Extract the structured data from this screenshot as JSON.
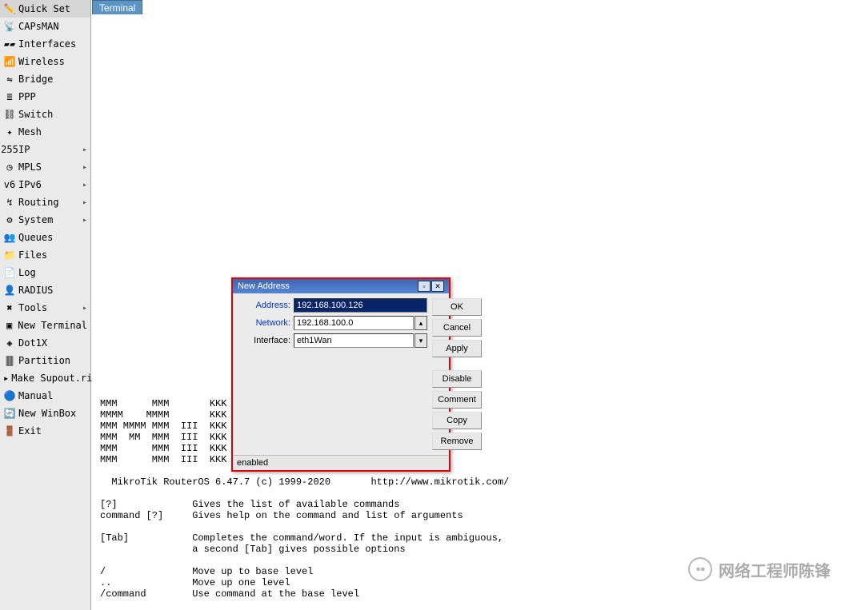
{
  "app_title": "Terminal",
  "sidebar": {
    "items": [
      {
        "label": "Quick Set",
        "icon": "✏️",
        "sub": false
      },
      {
        "label": "CAPsMAN",
        "icon": "📡",
        "sub": false
      },
      {
        "label": "Interfaces",
        "icon": "▰▰",
        "sub": false
      },
      {
        "label": "Wireless",
        "icon": "📶",
        "sub": false
      },
      {
        "label": "Bridge",
        "icon": "⇋",
        "sub": false
      },
      {
        "label": "PPP",
        "icon": "≣",
        "sub": false
      },
      {
        "label": "Switch",
        "icon": "⛓",
        "sub": false
      },
      {
        "label": "Mesh",
        "icon": "✦",
        "sub": false
      },
      {
        "label": "IP",
        "icon": "255",
        "sub": true
      },
      {
        "label": "MPLS",
        "icon": "◷",
        "sub": true
      },
      {
        "label": "IPv6",
        "icon": "v6",
        "sub": true
      },
      {
        "label": "Routing",
        "icon": "↯",
        "sub": true
      },
      {
        "label": "System",
        "icon": "⚙",
        "sub": true
      },
      {
        "label": "Queues",
        "icon": "👥",
        "sub": false
      },
      {
        "label": "Files",
        "icon": "📁",
        "sub": false
      },
      {
        "label": "Log",
        "icon": "📄",
        "sub": false
      },
      {
        "label": "RADIUS",
        "icon": "👤",
        "sub": false
      },
      {
        "label": "Tools",
        "icon": "✖",
        "sub": true
      },
      {
        "label": "New Terminal",
        "icon": "▣",
        "sub": false
      },
      {
        "label": "Dot1X",
        "icon": "◈",
        "sub": false
      },
      {
        "label": "Partition",
        "icon": "🀫",
        "sub": false
      },
      {
        "label": "Make Supout.rif",
        "icon": "▸",
        "sub": false
      },
      {
        "label": "Manual",
        "icon": "🔵",
        "sub": false
      },
      {
        "label": "New WinBox",
        "icon": "🔄",
        "sub": false
      },
      {
        "label": "Exit",
        "icon": "🚪",
        "sub": false
      }
    ]
  },
  "terminal": {
    "banner": "MMM      MMM       KKK                          KKK\nMMMM    MMMM       KKK                          KKK\nMMM MMMM MMM  III  KKK                     III  KKK  KKK\nMMM  MM  MMM  III  KKK                     III  KKKKK\nMMM      MMM  III  KKK                     III  KKK KKK\nMMM      MMM  III  KKK                     III  KKK  KKK\n\n  MikroTik RouterOS 6.47.7 (c) 1999-2020       http://www.mikrotik.com/\n\n[?]             Gives the list of available commands\ncommand [?]     Gives help on the command and list of arguments\n\n[Tab]           Completes the command/word. If the input is ambiguous,\n                a second [Tab] gives possible options\n\n/               Move up to base level\n..              Move up one level\n/command        Use command at the base level"
  },
  "dialog": {
    "title": "New Address",
    "fields": {
      "address_label": "Address:",
      "address_value": "192.168.100.126",
      "network_label": "Network:",
      "network_value": "192.168.100.0",
      "interface_label": "Interface:",
      "interface_value": "eth1Wan"
    },
    "buttons": {
      "ok": "OK",
      "cancel": "Cancel",
      "apply": "Apply",
      "disable": "Disable",
      "comment": "Comment",
      "copy": "Copy",
      "remove": "Remove"
    },
    "status": "enabled"
  },
  "watermark": {
    "text": "网络工程师陈锋"
  }
}
